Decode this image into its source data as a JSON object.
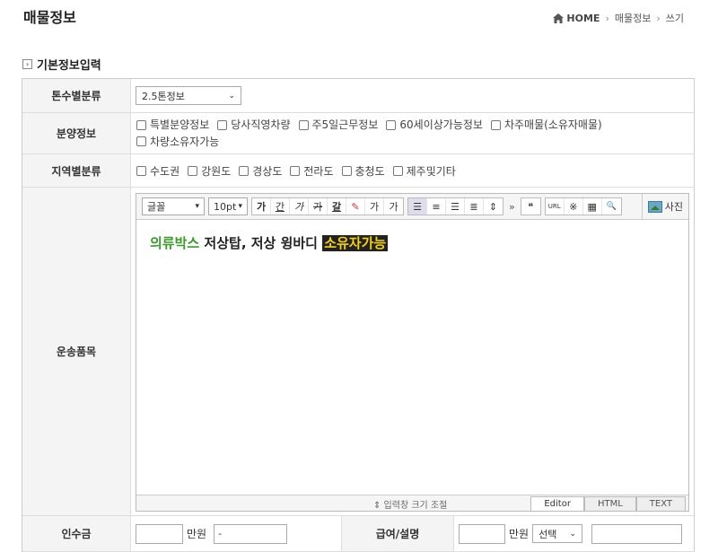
{
  "header": {
    "title": "매물정보"
  },
  "breadcrumb": {
    "home": "HOME",
    "level1": "매물정보",
    "level2": "쓰기"
  },
  "section": {
    "title": "기본정보입력"
  },
  "rows": {
    "tonnage": {
      "label": "톤수별분류",
      "selected": "2.5톤정보"
    },
    "sale": {
      "label": "분양정보",
      "options": [
        "특별분양정보",
        "당사직영차량",
        "주5일근무정보",
        "60세이상가능정보",
        "차주매물(소유자매물)",
        "차량소유자가능"
      ]
    },
    "region": {
      "label": "지역별분류",
      "options": [
        "수도권",
        "강원도",
        "경상도",
        "전라도",
        "충청도",
        "제주및기타"
      ]
    },
    "cargo": {
      "label": "운송품목"
    }
  },
  "editor": {
    "font_select": "글꼴",
    "size_select": "10pt",
    "toolbar": {
      "bold": "가",
      "underline": "간",
      "italic": "가",
      "strike": "가",
      "textcolor": "갈",
      "superscript": "가",
      "subscript": "가",
      "more": "»",
      "quote": "❝",
      "url": "URL",
      "special": "※",
      "table": "▦",
      "find": "🔍"
    },
    "photo_label": "사진",
    "content": {
      "part1": "의류박스",
      "part2": " 저상탑, 저상 윙바디 ",
      "part3": "소유자가능"
    },
    "resize_label": "⇕ 입력창 크기 조절",
    "modes": [
      "Editor",
      "HTML",
      "TEXT"
    ]
  },
  "bottom": {
    "label1": "인수금",
    "unit1": "만원",
    "input2": "-",
    "label2": "급여/설명",
    "unit2": "만원",
    "select_label": "선택"
  }
}
